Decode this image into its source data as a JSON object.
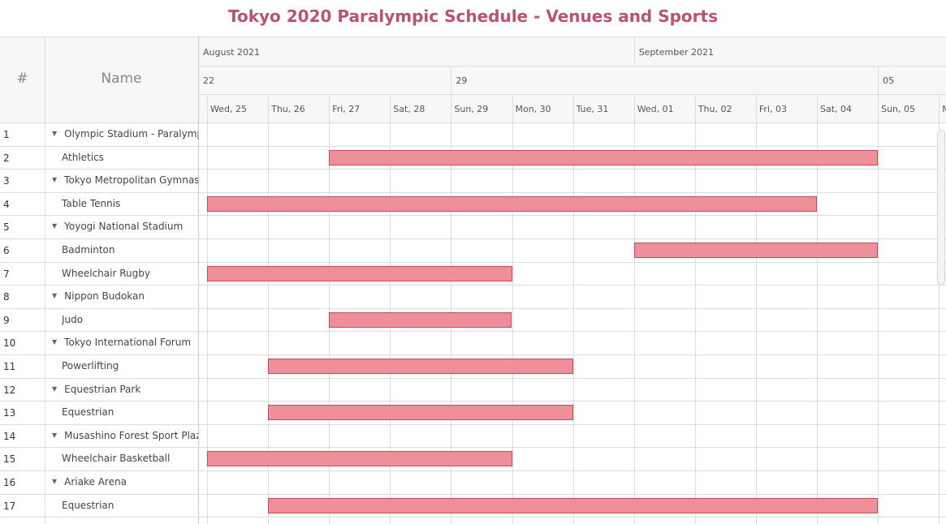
{
  "title": "Tokyo 2020 Paralympic Schedule - Venues and Sports",
  "columns": {
    "number": "#",
    "name": "Name"
  },
  "timeline": {
    "months": [
      "August 2021",
      "September 2021"
    ],
    "weeks": [
      "22",
      "29",
      "05"
    ],
    "days": [
      "Wed, 25",
      "Thu, 26",
      "Fri, 27",
      "Sat, 28",
      "Sun, 29",
      "Mon, 30",
      "Tue, 31",
      "Wed, 01",
      "Thu, 02",
      "Fri, 03",
      "Sat, 04",
      "Sun, 05",
      "M"
    ]
  },
  "rows": [
    {
      "num": "1",
      "name": "Olympic Stadium - Paralympic",
      "group": true
    },
    {
      "num": "2",
      "name": "Athletics",
      "group": false
    },
    {
      "num": "3",
      "name": "Tokyo Metropolitan Gymnasium",
      "group": true
    },
    {
      "num": "4",
      "name": "Table Tennis",
      "group": false
    },
    {
      "num": "5",
      "name": "Yoyogi National Stadium",
      "group": true
    },
    {
      "num": "6",
      "name": "Badminton",
      "group": false
    },
    {
      "num": "7",
      "name": "Wheelchair Rugby",
      "group": false
    },
    {
      "num": "8",
      "name": "Nippon Budokan",
      "group": true
    },
    {
      "num": "9",
      "name": "Judo",
      "group": false
    },
    {
      "num": "10",
      "name": "Tokyo International Forum",
      "group": true
    },
    {
      "num": "11",
      "name": "Powerlifting",
      "group": false
    },
    {
      "num": "12",
      "name": "Equestrian Park",
      "group": true
    },
    {
      "num": "13",
      "name": "Equestrian",
      "group": false
    },
    {
      "num": "14",
      "name": "Musashino Forest Sport Plaza",
      "group": true
    },
    {
      "num": "15",
      "name": "Wheelchair Basketball",
      "group": false
    },
    {
      "num": "16",
      "name": "Ariake Arena",
      "group": true
    },
    {
      "num": "17",
      "name": "Equestrian",
      "group": false
    }
  ],
  "colors": {
    "bar_fill": "#ef8f9a",
    "bar_border": "#c9475b",
    "title": "#b9546a"
  },
  "chart_data": {
    "type": "gantt",
    "tasks": [
      {
        "row": 2,
        "start": "2021-08-27",
        "end": "2021-09-05"
      },
      {
        "row": 4,
        "start": "2021-08-25",
        "end": "2021-09-04"
      },
      {
        "row": 6,
        "start": "2021-09-01",
        "end": "2021-09-05"
      },
      {
        "row": 7,
        "start": "2021-08-25",
        "end": "2021-08-30"
      },
      {
        "row": 9,
        "start": "2021-08-27",
        "end": "2021-08-30"
      },
      {
        "row": 11,
        "start": "2021-08-26",
        "end": "2021-08-31"
      },
      {
        "row": 13,
        "start": "2021-08-26",
        "end": "2021-08-31"
      },
      {
        "row": 15,
        "start": "2021-08-25",
        "end": "2021-08-30"
      },
      {
        "row": 17,
        "start": "2021-08-26",
        "end": "2021-09-05"
      }
    ]
  }
}
